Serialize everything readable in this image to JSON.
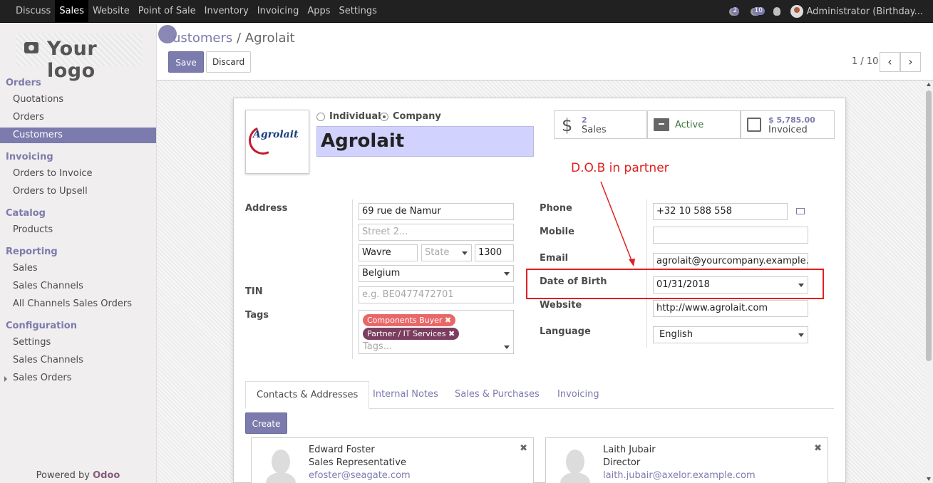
{
  "topnav": {
    "items": [
      "Discuss",
      "Sales",
      "Website",
      "Point of Sale",
      "Inventory",
      "Invoicing",
      "Apps",
      "Settings"
    ],
    "active": "Sales",
    "messages_count": "2",
    "activities_count": "10",
    "user": "Administrator (Birthday..."
  },
  "sidebar": {
    "logo_text": "Your logo",
    "sections": [
      {
        "title": "Orders",
        "items": [
          "Quotations",
          "Orders",
          "Customers"
        ]
      },
      {
        "title": "Invoicing",
        "items": [
          "Orders to Invoice",
          "Orders to Upsell"
        ]
      },
      {
        "title": "Catalog",
        "items": [
          "Products"
        ]
      },
      {
        "title": "Reporting",
        "items": [
          "Sales",
          "Sales Channels",
          "All Channels Sales Orders"
        ]
      },
      {
        "title": "Configuration",
        "items": [
          "Settings",
          "Sales Channels",
          "Sales Orders"
        ]
      }
    ],
    "active_item": "Customers",
    "powered_prefix": "Powered by ",
    "powered_brand": "Odoo"
  },
  "control_panel": {
    "breadcrumb_parent": "ustomers",
    "breadcrumb_sep": " / ",
    "breadcrumb_current": "Agrolait",
    "save_label": "Save",
    "discard_label": "Discard",
    "pager": "1 / 10",
    "prev_icon": "chevron-left-icon",
    "next_icon": "chevron-right-icon"
  },
  "form": {
    "logo_text": "Agrolait",
    "type_options": [
      "Individual",
      "Company"
    ],
    "type_selected": "Company",
    "name": "Agrolait",
    "stats": [
      {
        "icon": "dollar-icon",
        "value": "2",
        "label": "Sales"
      },
      {
        "icon": "archive-icon",
        "value": "",
        "label": "Active"
      },
      {
        "icon": "edit-icon",
        "value": "$ 5,785.00",
        "label": "Invoiced"
      }
    ],
    "address_label": "Address",
    "street": "69 rue de Namur",
    "street2_placeholder": "Street 2...",
    "city": "Wavre",
    "state_placeholder": "State",
    "zip": "1300",
    "country": "Belgium",
    "tin_label": "TIN",
    "tin_placeholder": "e.g. BE0477472701",
    "tags_label": "Tags",
    "tags": [
      {
        "label": "Components Buyer",
        "color": "#e86868"
      },
      {
        "label": "Partner / IT Services",
        "color": "#7b3e60"
      }
    ],
    "tags_placeholder": "Tags...",
    "phone_label": "Phone",
    "phone": "+32 10 588 558",
    "mobile_label": "Mobile",
    "mobile": "",
    "email_label": "Email",
    "email": "agrolait@yourcompany.example.com",
    "dob_label": "Date of Birth",
    "dob": "01/31/2018",
    "website_label": "Website",
    "website": "http://www.agrolait.com",
    "language_label": "Language",
    "language": "English"
  },
  "tabs": [
    "Contacts & Addresses",
    "Internal Notes",
    "Sales & Purchases",
    "Invoicing"
  ],
  "active_tab": "Contacts & Addresses",
  "create_label": "Create",
  "contacts": [
    {
      "name": "Edward Foster",
      "role": "Sales Representative",
      "email": "efoster@seagate.com"
    },
    {
      "name": "Laith Jubair",
      "role": "Director",
      "email": "laith.jubair@axelor.example.com"
    }
  ],
  "annotation": {
    "text": "D.O.B in partner",
    "color": "#e02020"
  },
  "colors": {
    "accent": "#7c7bad",
    "topbar": "#212121",
    "name_field": "#d2d2ff"
  }
}
